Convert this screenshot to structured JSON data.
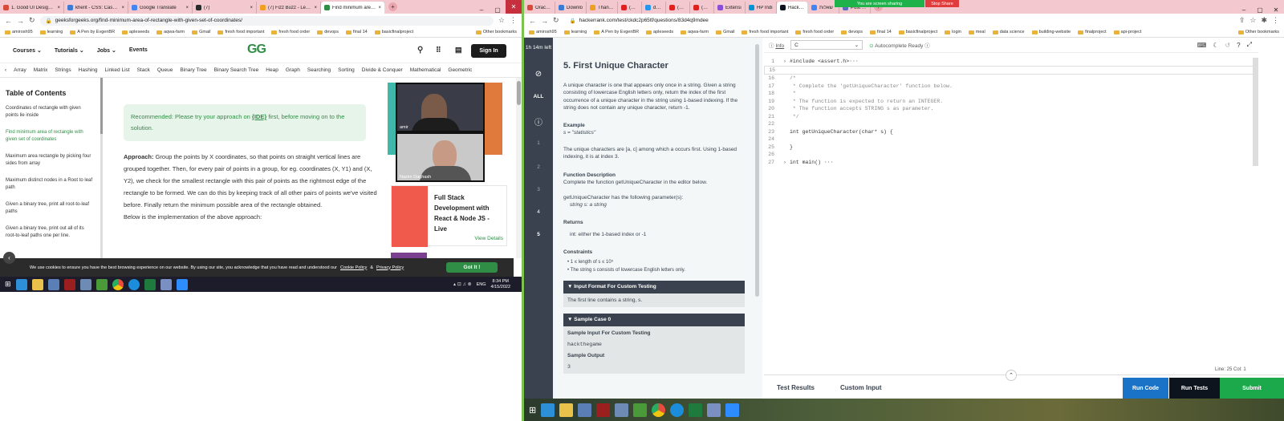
{
  "left_browser": {
    "tabs": [
      {
        "label": "1. Good UI Design Wi"
      },
      {
        "label": "kherit - CSS: Cascadin"
      },
      {
        "label": "Google Translate"
      },
      {
        "label": "(7)"
      },
      {
        "label": "(7) Fizz Buzz - LeetCo"
      },
      {
        "label": "Find minimum area of"
      }
    ],
    "url": "geeksforgeeks.org/find-minimum-area-of-rectangle-with-given-set-of-coordinates/",
    "bookmarks": [
      "amirosh95",
      "learning",
      "A Pen by EvgenBR",
      "apleseeds",
      "aqwa-farm",
      "Gmail",
      "fresh food important",
      "fresh food order",
      "devops",
      "final 14",
      "basicfinalproject"
    ],
    "other_bookmarks": "Other bookmarks"
  },
  "gfg": {
    "nav": [
      "Courses",
      "Tutorials",
      "Jobs",
      "Events"
    ],
    "logo": "GG",
    "signin": "Sign In",
    "topics": [
      "Array",
      "Matrix",
      "Strings",
      "Hashing",
      "Linked List",
      "Stack",
      "Queue",
      "Binary Tree",
      "Binary Search Tree",
      "Heap",
      "Graph",
      "Searching",
      "Sorting",
      "Divide & Conquer",
      "Mathematical",
      "Geometric"
    ],
    "toc_title": "Table of Contents",
    "toc_items": [
      "Coordinates of rectangle with given points lie inside",
      "Find minimum area of rectangle with given set of coordinates",
      "Maximum area rectangle by picking four sides from array",
      "Maximum distinct nodes in a Root to leaf path",
      "Given a binary tree, print all root-to-leaf paths",
      "Given a binary tree, print out all of its root-to-leaf paths one per line."
    ],
    "reco_text_1": "Recommended: Please try your approach on ",
    "reco_link": "{IDE}",
    "reco_text_2": " first, before moving on to the solution.",
    "approach_label": "Approach:",
    "approach_text": " Group the points by X coordinates, so that points on straight vertical lines are grouped together. Then, for every pair of points in a group, for eg. coordinates (X, Y1) and (X, Y2), we check for the smallest rectangle with this pair of points as the rightmost edge of the rectangle to be formed. We can do this by keeping track of all other pairs of points we've visited before. Finally return the minimum possible area of the rectangle obtained.",
    "below_text": "Below is the implementation of the above approach:",
    "ad_title": "Full Stack Development with React & Node JS - Live",
    "ad_link": "View Details",
    "video_name_1": "amir",
    "video_name_2": "Nazim Daghash",
    "cookie_text": "We use cookies to ensure you have the best browsing experience on our website. By using our site, you acknowledge that you have read and understood our",
    "cookie_link1": "Cookie Policy",
    "cookie_and": "&",
    "cookie_link2": "Privacy Policy",
    "gotit": "Got It !"
  },
  "left_taskbar": {
    "lang": "ENG",
    "time": "8:34 PM",
    "date": "4/15/2022"
  },
  "right_browser": {
    "tabs": [
      {
        "label": "Oracle V"
      },
      {
        "label": "Downlo"
      },
      {
        "label": "Thank yo"
      },
      {
        "label": "(709) D"
      },
      {
        "label": "docker V"
      },
      {
        "label": "(709) Do"
      },
      {
        "label": "(709) bu"
      },
      {
        "label": "Extensi"
      },
      {
        "label": "HP Indi"
      },
      {
        "label": "HackerR"
      },
      {
        "label": "שאלות"
      },
      {
        "label": "Post Att"
      }
    ],
    "sharing": "You are screen sharing",
    "stop_share": "Stop Share",
    "url": "hackerrank.com/test/ckdc2p65tf/questions/83d4q9mdee",
    "bookmarks": [
      "amirosh95",
      "learning",
      "A Pen by EvgenBR",
      "apleseeds",
      "aqwa-farm",
      "Gmail",
      "fresh food important",
      "fresh food order",
      "devops",
      "final 14",
      "basicfinalproject",
      "login",
      "meal",
      "data science",
      "building-website",
      "finalproject",
      "api-project"
    ],
    "other_bookmarks": "Other bookmarks"
  },
  "hr": {
    "timer": "1h 14m left",
    "all": "ALL",
    "steps": [
      "1",
      "2",
      "3",
      "4",
      "5"
    ],
    "title": "5. First Unique Character",
    "intro": "A unique character is one that appears only once in a string. Given a string consisting of lowercase English letters only, return the index of the first occurrence of a unique character in the string using 1-based indexing. If the string does not contain any unique character, return -1.",
    "example_h": "Example",
    "example_s": "s = \"statistics\"",
    "example_text": "The unique characters are [a, c] among which a occurs first. Using 1-based indexing, it is at index 3.",
    "fd_h": "Function Description",
    "fd_text": "Complete the function getUniqueCharacter in the editor below.",
    "param_text": "getUniqueCharacter has the following parameter(s):",
    "param": "string s:  a string",
    "returns_h": "Returns",
    "returns_text": "int: either the 1-based index or -1",
    "constraints_h": "Constraints",
    "c1": "1 ≤ length of s ≤ 10⁵",
    "c2": "The string s consists of lowercase English letters only.",
    "input_h": "▼ Input Format For Custom Testing",
    "input_text": "The first line contains a string, s.",
    "sample_h": "▼ Sample Case 0",
    "sample_in_h": "Sample Input For Custom Testing",
    "sample_in": "hackthegame",
    "sample_out_h": "Sample Output",
    "sample_out": "3",
    "info": "Info",
    "lang": "C",
    "autocomplete": "Autocomplete Ready",
    "code": [
      {
        "n": "1",
        "t": "#include <assert.h>···"
      },
      {
        "n": "15",
        "t": ""
      },
      {
        "n": "16",
        "t": "/*"
      },
      {
        "n": "17",
        "t": " * Complete the 'getUniqueCharacter' function below."
      },
      {
        "n": "18",
        "t": " *"
      },
      {
        "n": "19",
        "t": " * The function is expected to return an INTEGER."
      },
      {
        "n": "20",
        "t": " * The function accepts STRING s as parameter."
      },
      {
        "n": "21",
        "t": " */"
      },
      {
        "n": "22",
        "t": ""
      },
      {
        "n": "23",
        "t": "int getUniqueCharacter(char* s) {"
      },
      {
        "n": "24",
        "t": ""
      },
      {
        "n": "25",
        "t": "}"
      },
      {
        "n": "26",
        "t": ""
      },
      {
        "n": "27",
        "t": "int main() ···"
      }
    ],
    "cursor": "Line: 25 Col: 1",
    "test_results": "Test Results",
    "custom_input": "Custom Input",
    "run_code": "Run Code",
    "run_tests": "Run Tests",
    "submit": "Submit"
  },
  "colors": {
    "gfg_green": "#2f8d46",
    "hr_dark": "#39424e",
    "run_code": "#1a73c7",
    "submit": "#1ba94c",
    "tabbar": "#f3c9cf"
  }
}
